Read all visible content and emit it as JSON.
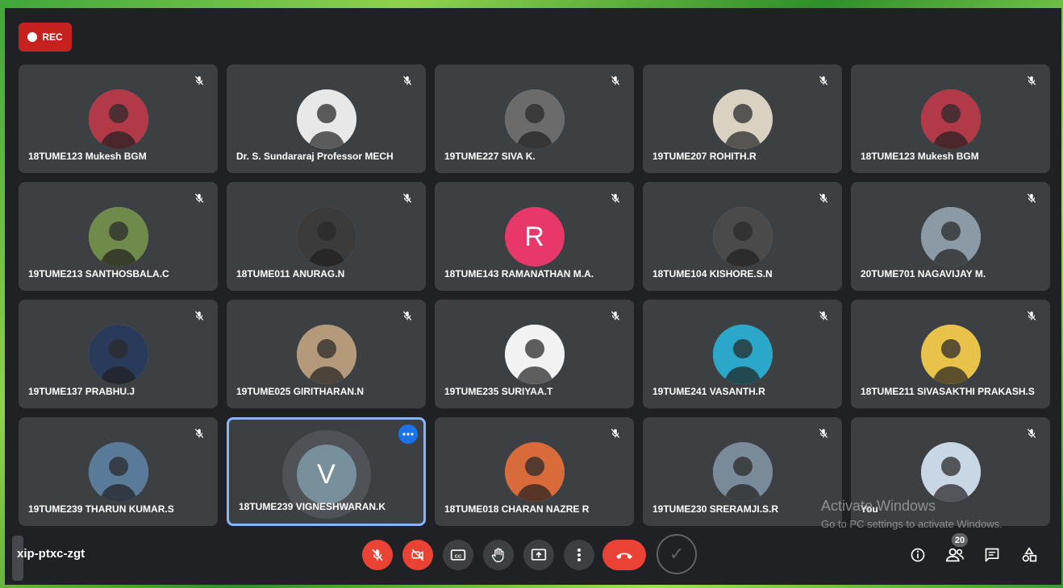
{
  "recording": {
    "label": "REC"
  },
  "meeting": {
    "code": "xip-ptxc-zgt"
  },
  "participants": [
    {
      "name": "18TUME123 Mukesh BGM",
      "avatar": "photo",
      "bg": "#b23a48"
    },
    {
      "name": "Dr. S. Sundararaj Professor MECH",
      "avatar": "photo",
      "bg": "#e8e8e8"
    },
    {
      "name": "19TUME227 SIVA K.",
      "avatar": "photo",
      "bg": "#6b6b6b"
    },
    {
      "name": "19TUME207 ROHITH.R",
      "avatar": "photo",
      "bg": "#d9d2c3"
    },
    {
      "name": "18TUME123 Mukesh BGM",
      "avatar": "photo",
      "bg": "#b23a48"
    },
    {
      "name": "19TUME213 SANTHOSBALA.C",
      "avatar": "photo",
      "bg": "#6f8a4a"
    },
    {
      "name": "18TUME011 ANURAG.N",
      "avatar": "photo",
      "bg": "#3b3b3b"
    },
    {
      "name": "18TUME143 RAMANATHAN M.A.",
      "avatar": "letter",
      "letter": "R",
      "bg": "#e8386a"
    },
    {
      "name": "18TUME104 KISHORE.S.N",
      "avatar": "photo",
      "bg": "#4a4a4a"
    },
    {
      "name": "20TUME701 NAGAVIJAY M.",
      "avatar": "photo",
      "bg": "#8c9aa6"
    },
    {
      "name": "19TUME137 PRABHU.J",
      "avatar": "photo",
      "bg": "#2a3a5a"
    },
    {
      "name": "19TUME025 GIRITHARAN.N",
      "avatar": "photo",
      "bg": "#b49a7a"
    },
    {
      "name": "19TUME235 SURIYAA.T",
      "avatar": "photo",
      "bg": "#f2f2f2"
    },
    {
      "name": "19TUME241 VASANTH.R",
      "avatar": "photo",
      "bg": "#2aa7c9"
    },
    {
      "name": "18TUME211 SIVASAKTHI PRAKASH.S",
      "avatar": "photo",
      "bg": "#e9c24a"
    },
    {
      "name": "19TUME239 THARUN KUMAR.S",
      "avatar": "photo",
      "bg": "#5a7a9a"
    },
    {
      "name": "18TUME239 VIGNESHWARAN.K",
      "avatar": "letter",
      "letter": "V",
      "bg": "#78909c",
      "active": true
    },
    {
      "name": "18TUME018 CHARAN NAZRE R",
      "avatar": "photo",
      "bg": "#d96a3a"
    },
    {
      "name": "19TUME230 SRERAMJI.S.R",
      "avatar": "photo",
      "bg": "#7a8a99"
    },
    {
      "name": "You",
      "avatar": "photo",
      "bg": "#c9d6e3",
      "self": true
    }
  ],
  "watermark": {
    "line1": "Activate Windows",
    "line2": "Go to PC settings to activate Windows."
  },
  "people_count": "20",
  "colors": {
    "accent": "#8ab4f8",
    "danger": "#ea4335",
    "tile": "#3c4043",
    "background": "#202124"
  }
}
